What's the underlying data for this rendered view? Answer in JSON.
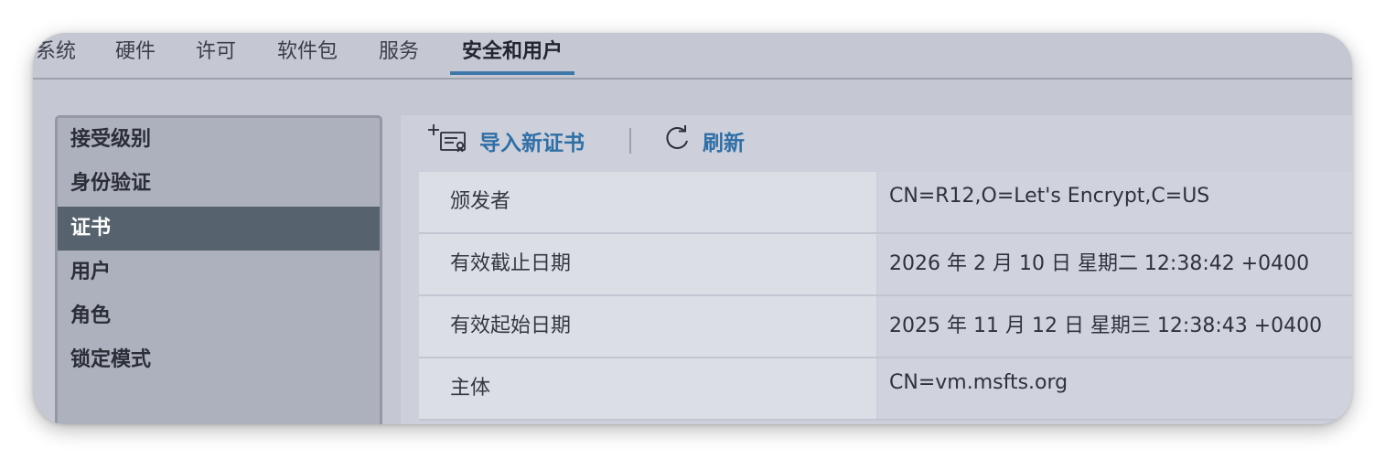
{
  "tabs": [
    "系统",
    "硬件",
    "许可",
    "软件包",
    "服务",
    "安全和用户"
  ],
  "active_tab": "安全和用户",
  "sidebar": {
    "items": [
      {
        "label": "接受级别"
      },
      {
        "label": "身份验证"
      },
      {
        "label": "证书",
        "selected": true
      },
      {
        "label": "用户"
      },
      {
        "label": "角色"
      },
      {
        "label": "锁定模式"
      }
    ]
  },
  "toolbar": {
    "import_label": "导入新证书",
    "import_icon": "certificate-add-icon",
    "refresh_label": "刷新",
    "refresh_icon": "refresh-icon"
  },
  "certificate": {
    "rows": [
      {
        "label": "颁发者",
        "value": "CN=R12,O=Let's Encrypt,C=US"
      },
      {
        "label": "有效截止日期",
        "value": "2026 年 2 月 10 日 星期二 12:38:42 +0400"
      },
      {
        "label": "有效起始日期",
        "value": "2025 年 11 月 12 日 星期三 12:38:43 +0400"
      },
      {
        "label": "主体",
        "value": "CN=vm.msfts.org"
      }
    ]
  },
  "colors": {
    "accent": "#2f6fa6",
    "tab_underline": "#3d78a8",
    "selected_bg": "#56636e"
  }
}
